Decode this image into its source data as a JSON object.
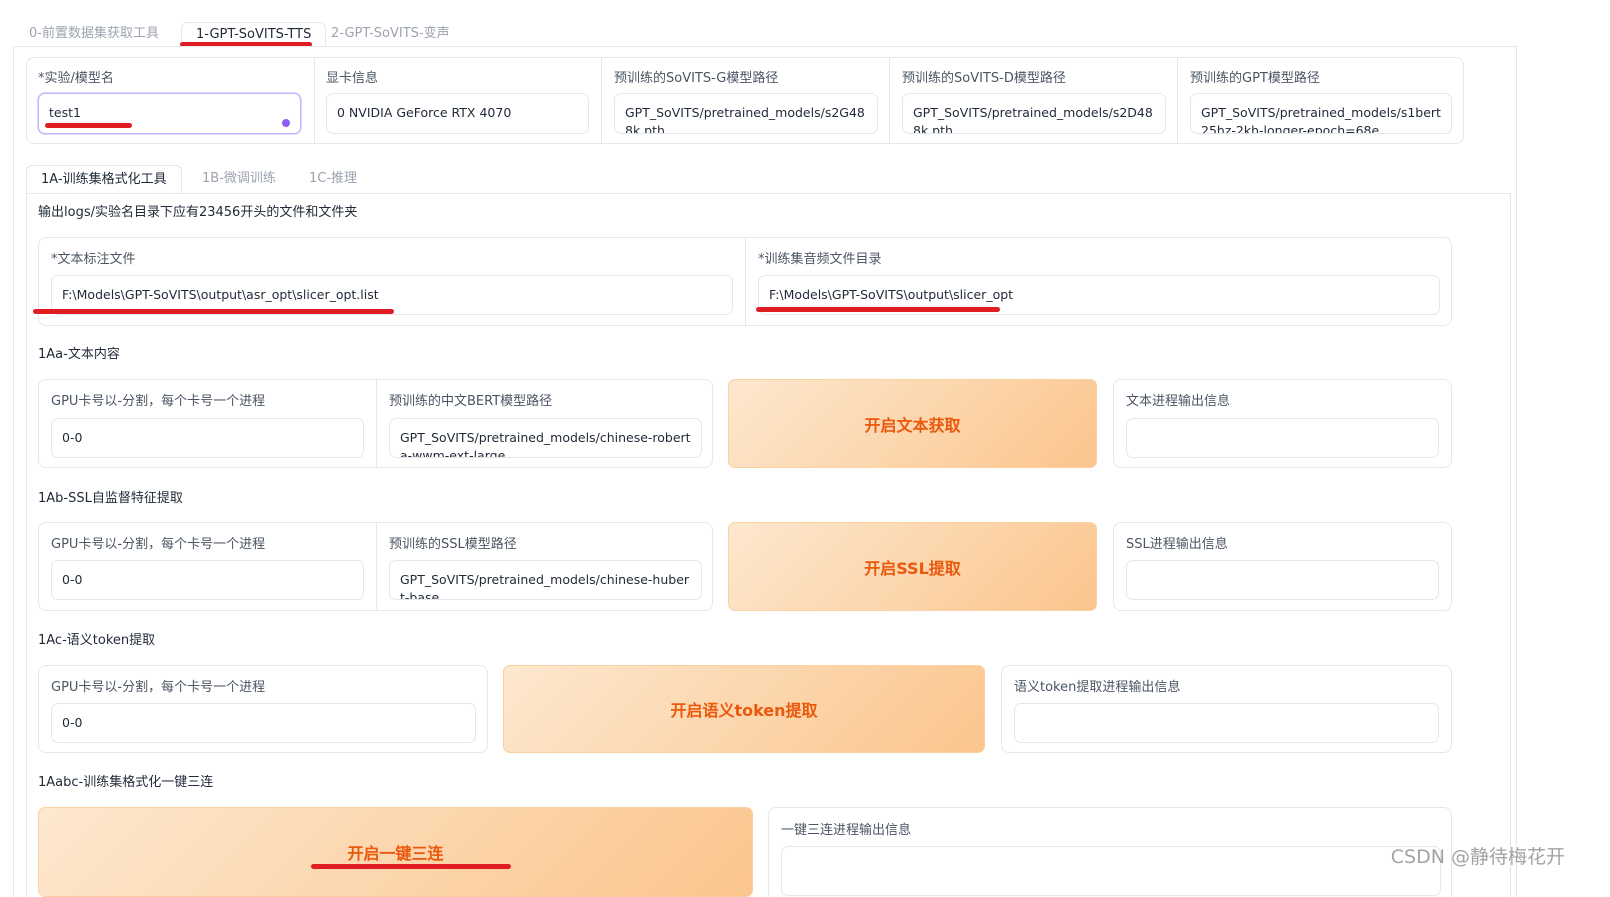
{
  "top_tabs": [
    {
      "label": "0-前置数据集获取工具"
    },
    {
      "label": "1-GPT-SoVITS-TTS"
    },
    {
      "label": "2-GPT-SoVITS-变声"
    }
  ],
  "config": {
    "exp_name": {
      "label": "*实验/模型名",
      "value": "test1"
    },
    "gpu_info": {
      "label": "显卡信息",
      "value": "0 NVIDIA GeForce RTX 4070"
    },
    "sovits_g": {
      "label": "预训练的SoVITS-G模型路径",
      "value": "GPT_SoVITS/pretrained_models/s2G488k.pth"
    },
    "sovits_d": {
      "label": "预训练的SoVITS-D模型路径",
      "value": "GPT_SoVITS/pretrained_models/s2D488k.pth"
    },
    "gpt": {
      "label": "预训练的GPT模型路径",
      "value": "GPT_SoVITS/pretrained_models/s1bert25hz-2kh-longer-epoch=68e"
    }
  },
  "sub_tabs": [
    {
      "label": "1A-训练集格式化工具"
    },
    {
      "label": "1B-微调训练"
    },
    {
      "label": "1C-推理"
    }
  ],
  "hint": "输出logs/实验名目录下应有23456开头的文件和文件夹",
  "files": {
    "text_label": {
      "label": "*文本标注文件",
      "value": "F:\\Models\\GPT-SoVITS\\output\\asr_opt\\slicer_opt.list"
    },
    "audio_dir": {
      "label": "*训练集音频文件目录",
      "value": "F:\\Models\\GPT-SoVITS\\output\\slicer_opt"
    }
  },
  "section_a": {
    "title": "1Aa-文本内容",
    "gpu_label": "GPU卡号以-分割，每个卡号一个进程",
    "gpu_value": "0-0",
    "bert_label": "预训练的中文BERT模型路径",
    "bert_value": "GPT_SoVITS/pretrained_models/chinese-roberta-wwm-ext-large",
    "button": "开启文本获取",
    "output_label": "文本进程输出信息",
    "output_value": ""
  },
  "section_b": {
    "title": "1Ab-SSL自监督特征提取",
    "gpu_label": "GPU卡号以-分割，每个卡号一个进程",
    "gpu_value": "0-0",
    "ssl_label": "预训练的SSL模型路径",
    "ssl_value": "GPT_SoVITS/pretrained_models/chinese-hubert-base",
    "button": "开启SSL提取",
    "output_label": "SSL进程输出信息",
    "output_value": ""
  },
  "section_c": {
    "title": "1Ac-语义token提取",
    "gpu_label": "GPU卡号以-分割，每个卡号一个进程",
    "gpu_value": "0-0",
    "button": "开启语义token提取",
    "output_label": "语义token提取进程输出信息",
    "output_value": ""
  },
  "section_d": {
    "title": "1Aabc-训练集格式化一键三连",
    "button": "开启一键三连",
    "output_label": "一键三连进程输出信息",
    "output_value": ""
  },
  "watermark": "CSDN @静待梅花开",
  "colors": {
    "accent_orange": "#ea580c",
    "annotation_red": "#e11d24",
    "focus_purple": "#8b5cf6"
  }
}
